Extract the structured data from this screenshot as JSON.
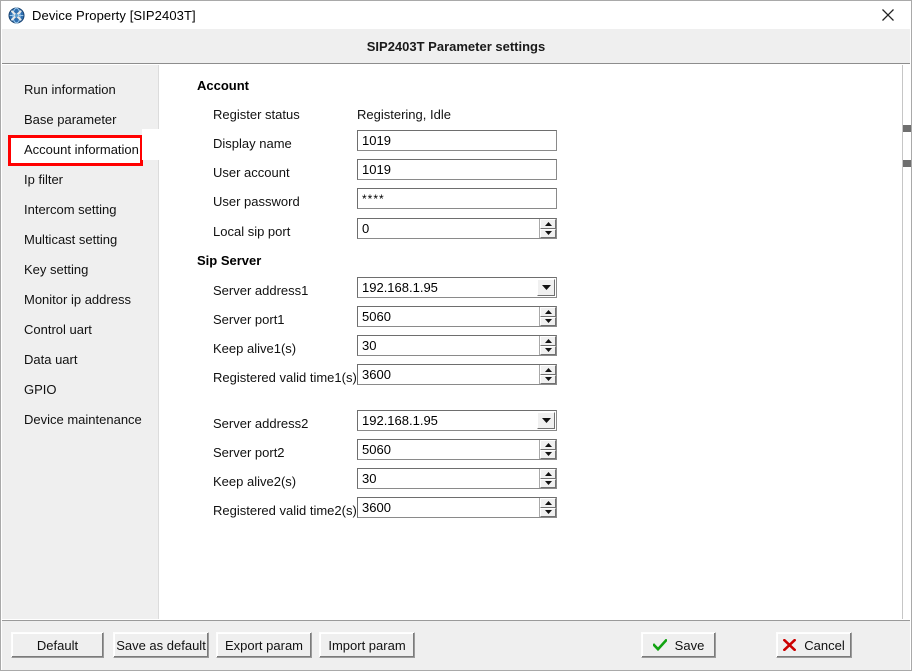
{
  "window": {
    "title": "Device Property [SIP2403T]",
    "icon": "device-globe-icon",
    "close_label": "close-icon"
  },
  "header": {
    "title": "SIP2403T Parameter settings"
  },
  "sidebar": {
    "items": [
      {
        "label": "Run information",
        "selected": false
      },
      {
        "label": "Base parameter",
        "selected": false
      },
      {
        "label": "Account information",
        "selected": true
      },
      {
        "label": "Ip filter",
        "selected": false
      },
      {
        "label": "Intercom setting",
        "selected": false
      },
      {
        "label": "Multicast setting",
        "selected": false
      },
      {
        "label": "Key setting",
        "selected": false
      },
      {
        "label": "Monitor ip address",
        "selected": false
      },
      {
        "label": "Control uart",
        "selected": false
      },
      {
        "label": "Data uart",
        "selected": false
      },
      {
        "label": "GPIO",
        "selected": false
      },
      {
        "label": "Device maintenance",
        "selected": false
      }
    ],
    "highlight_color": "#ff0000"
  },
  "account_section": {
    "title": "Account",
    "register_status_label": "Register status",
    "register_status_value": "Registering, Idle",
    "display_name_label": "Display name",
    "display_name_value": "1019",
    "user_account_label": "User account",
    "user_account_value": "1019",
    "user_password_label": "User password",
    "user_password_value": "****",
    "local_sip_port_label": "Local sip port",
    "local_sip_port_value": "0"
  },
  "sip_server_section": {
    "title": "Sip Server",
    "server_address1_label": "Server address1",
    "server_address1_value": "192.168.1.95",
    "server_port1_label": "Server port1",
    "server_port1_value": "5060",
    "keep_alive1_label": "Keep alive1(s)",
    "keep_alive1_value": "30",
    "registered_valid_time1_label": "Registered valid time1(s)",
    "registered_valid_time1_value": "3600",
    "server_address2_label": "Server address2",
    "server_address2_value": "192.168.1.95",
    "server_port2_label": "Server port2",
    "server_port2_value": "5060",
    "keep_alive2_label": "Keep alive2(s)",
    "keep_alive2_value": "30",
    "registered_valid_time2_label": "Registered valid time2(s)",
    "registered_valid_time2_value": "3600"
  },
  "footer": {
    "default_label": "Default",
    "save_as_default_label": "Save as default",
    "export_param_label": "Export param",
    "import_param_label": "Import param",
    "save_label": "Save",
    "cancel_label": "Cancel",
    "save_icon": "green-check-icon",
    "cancel_icon": "red-cross-icon",
    "save_icon_color": "#11a311",
    "cancel_icon_color": "#cc0000"
  }
}
